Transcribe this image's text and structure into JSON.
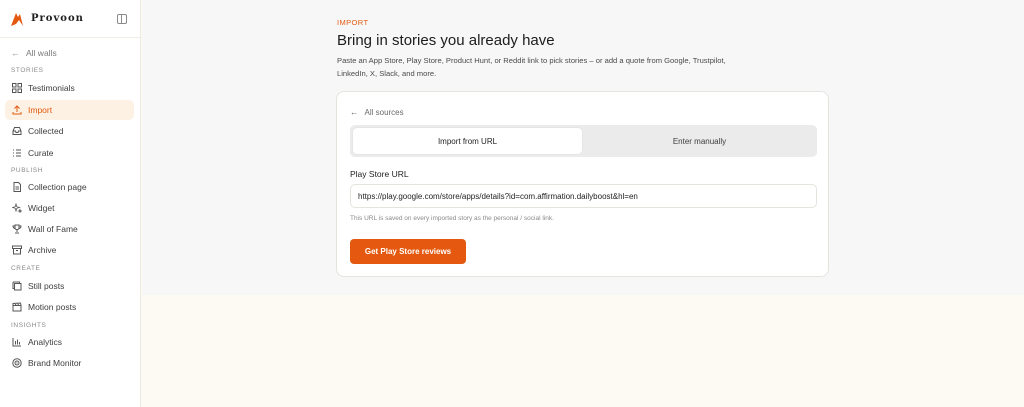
{
  "brand": {
    "name": "Provoon"
  },
  "sidebar": {
    "back_label": "All walls",
    "sections": [
      {
        "label": "STORIES",
        "items": [
          {
            "label": "Testimonials",
            "icon": "grid-icon"
          },
          {
            "label": "Import",
            "icon": "upload-icon",
            "active": true
          },
          {
            "label": "Collected",
            "icon": "inbox-icon"
          },
          {
            "label": "Curate",
            "icon": "list-icon"
          }
        ]
      },
      {
        "label": "PUBLISH",
        "items": [
          {
            "label": "Collection page",
            "icon": "page-icon"
          },
          {
            "label": "Widget",
            "icon": "sparkle-icon"
          },
          {
            "label": "Wall of Fame",
            "icon": "trophy-icon"
          },
          {
            "label": "Archive",
            "icon": "archive-icon"
          }
        ]
      },
      {
        "label": "CREATE",
        "items": [
          {
            "label": "Still posts",
            "icon": "image-icon"
          },
          {
            "label": "Motion posts",
            "icon": "clapper-icon"
          }
        ]
      },
      {
        "label": "INSIGHTS",
        "items": [
          {
            "label": "Analytics",
            "icon": "bar-chart-icon"
          },
          {
            "label": "Brand Monitor",
            "icon": "radar-icon"
          }
        ]
      }
    ]
  },
  "main": {
    "eyebrow": "IMPORT",
    "title": "Bring in stories you already have",
    "description": "Paste an App Store, Play Store, Product Hunt, or Reddit link to pick stories – or add a quote from Google, Trustpilot, LinkedIn, X, Slack, and more.",
    "card": {
      "back_label": "All sources",
      "tabs": {
        "url": "Import from URL",
        "manual": "Enter manually"
      },
      "field_label": "Play Store URL",
      "url_value": "https://play.google.com/store/apps/details?id=com.affirmation.dailyboost&hl=en",
      "help_text": "This URL is saved on every imported story as the personal / social link.",
      "button_label": "Get Play Store reviews"
    }
  },
  "colors": {
    "accent": "#e4590f",
    "active_bg": "#fdf1e4"
  }
}
